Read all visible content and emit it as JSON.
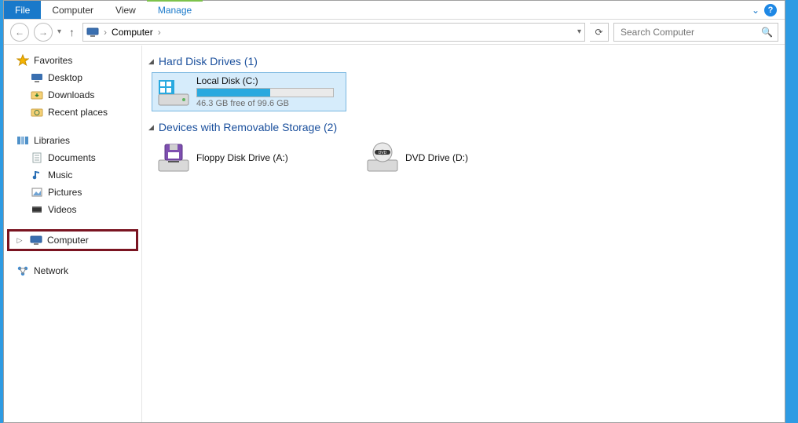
{
  "ribbon": {
    "file": "File",
    "tabs": [
      "Computer",
      "View"
    ],
    "context_tab": "Manage",
    "expand_glyph": "⌄",
    "help_glyph": "?"
  },
  "nav": {
    "back_glyph": "←",
    "fwd_glyph": "→",
    "recent_glyph": "▾",
    "up_glyph": "↑",
    "crumb": "Computer",
    "crumb_sep": "›",
    "history_glyph": "▾",
    "refresh_glyph": "⟳",
    "search_placeholder": "Search Computer",
    "search_glyph": "🔍"
  },
  "sidebar": {
    "favorites": {
      "label": "Favorites",
      "items": [
        {
          "label": "Desktop",
          "icon": "desktop"
        },
        {
          "label": "Downloads",
          "icon": "downloads"
        },
        {
          "label": "Recent places",
          "icon": "recent"
        }
      ]
    },
    "libraries": {
      "label": "Libraries",
      "items": [
        {
          "label": "Documents",
          "icon": "documents"
        },
        {
          "label": "Music",
          "icon": "music"
        },
        {
          "label": "Pictures",
          "icon": "pictures"
        },
        {
          "label": "Videos",
          "icon": "videos"
        }
      ]
    },
    "computer": {
      "label": "Computer",
      "selected": true,
      "highlighted": true
    },
    "network": {
      "label": "Network"
    }
  },
  "content": {
    "sections": [
      {
        "header": "Hard Disk Drives (1)",
        "items": [
          {
            "name": "Local Disk (C:)",
            "subtitle": "46.3 GB free of 99.6 GB",
            "fill_pct": 53.5,
            "selected": true,
            "kind": "hdd"
          }
        ]
      },
      {
        "header": "Devices with Removable Storage (2)",
        "items": [
          {
            "name": "Floppy Disk Drive (A:)",
            "kind": "floppy"
          },
          {
            "name": "DVD Drive (D:)",
            "kind": "dvd"
          }
        ]
      }
    ]
  }
}
